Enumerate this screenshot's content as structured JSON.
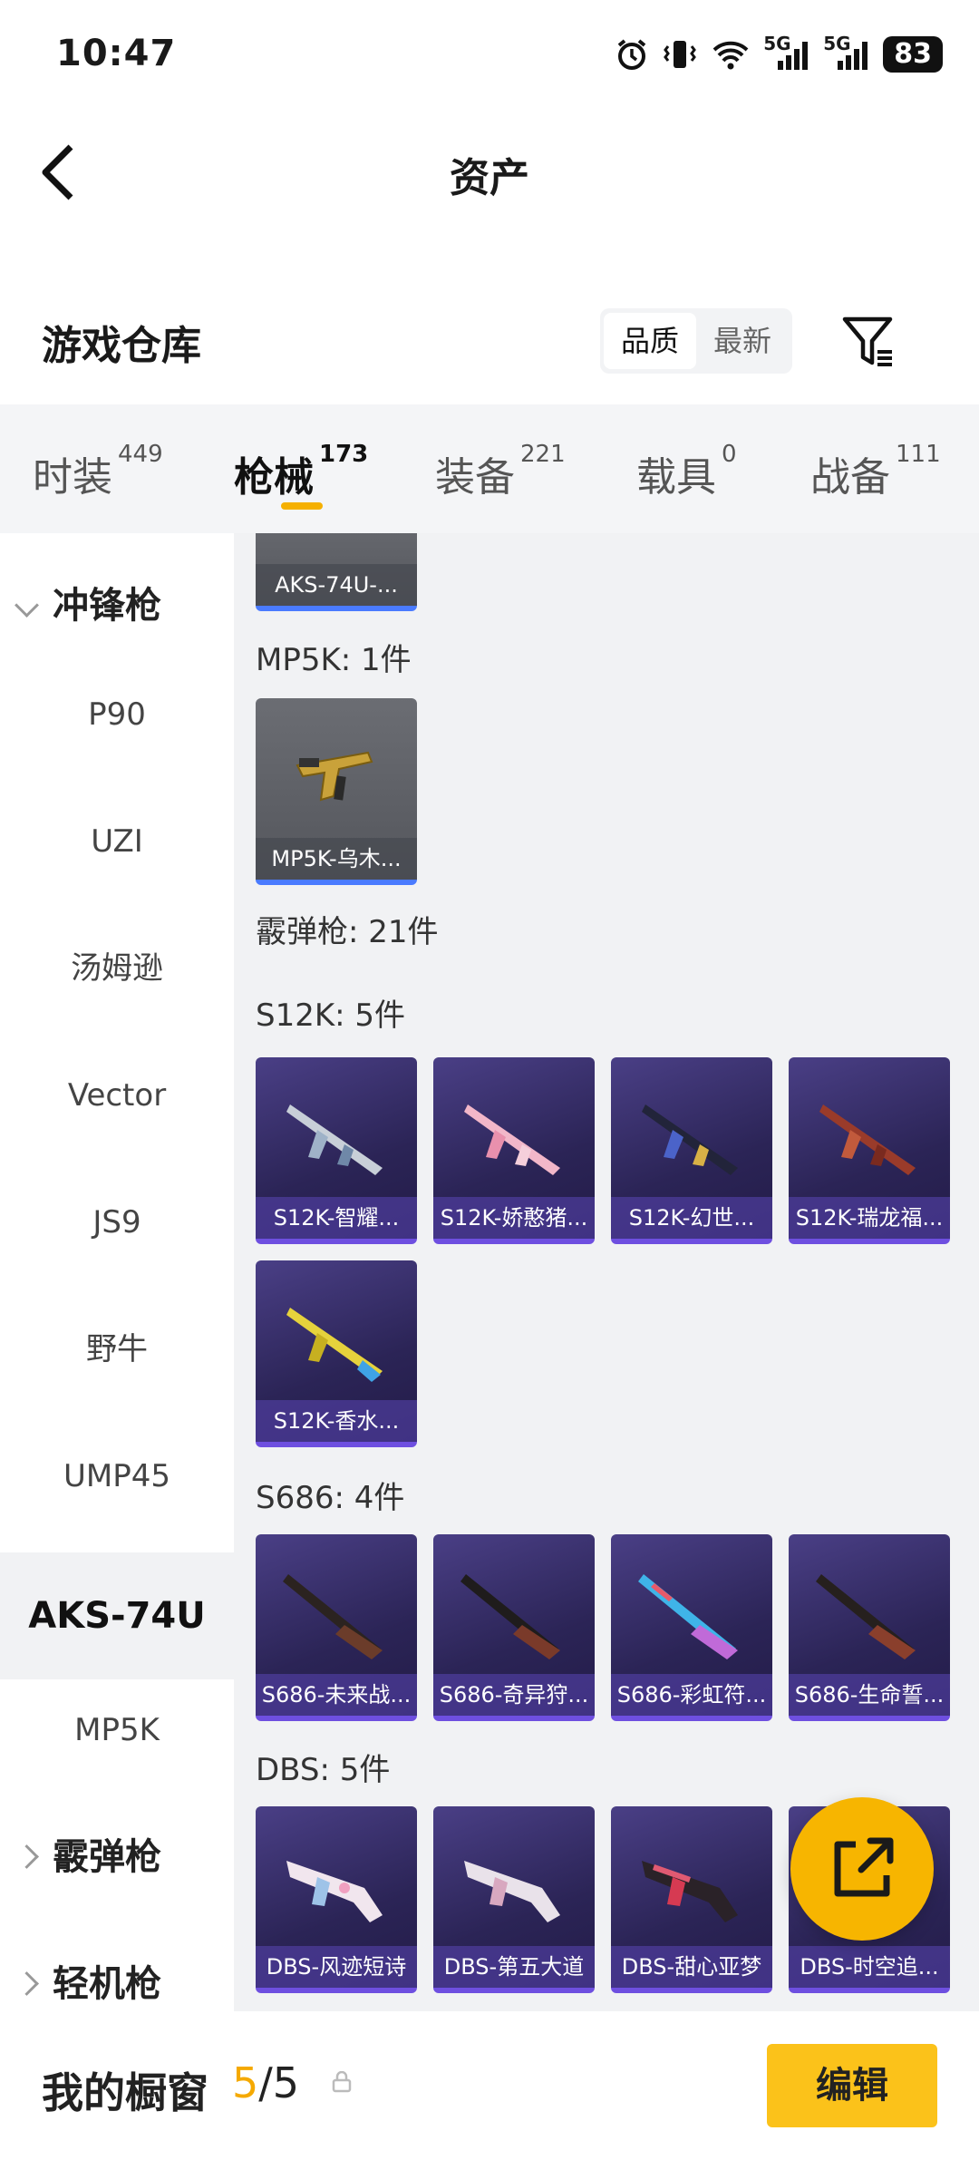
{
  "status_bar": {
    "time": "10:47",
    "signal_1": "5G",
    "signal_2": "5G",
    "battery": "83"
  },
  "header": {
    "title": "资产"
  },
  "warehouse": {
    "title": "游戏仓库",
    "sort_quality": "品质",
    "sort_newest": "最新"
  },
  "tabs": [
    {
      "label": "时装",
      "count": "449"
    },
    {
      "label": "枪械",
      "count": "173"
    },
    {
      "label": "装备",
      "count": "221"
    },
    {
      "label": "载具",
      "count": "0"
    },
    {
      "label": "战备",
      "count": "111"
    }
  ],
  "sidebar": {
    "group_smg": "冲锋枪",
    "items": [
      "P90",
      "UZI",
      "汤姆逊",
      "Vector",
      "JS9",
      "野牛",
      "UMP45",
      "AKS-74U",
      "MP5K"
    ],
    "selected": "AKS-74U",
    "group_shotgun": "霰弹枪",
    "group_lmg": "轻机枪"
  },
  "main": {
    "partial_card": "AKS-74U-...",
    "mp5k_label": "MP5K: 1件",
    "mp5k_cards": [
      "MP5K-乌木..."
    ],
    "shotgun_label": "霰弹枪: 21件",
    "s12k_label": "S12K: 5件",
    "s12k_cards": [
      "S12K-智耀...",
      "S12K-娇憨猪...",
      "S12K-幻世...",
      "S12K-瑞龙福...",
      "S12K-香水..."
    ],
    "s686_label": "S686: 4件",
    "s686_cards": [
      "S686-未来战...",
      "S686-奇异狩...",
      "S686-彩虹符...",
      "S686-生命誓..."
    ],
    "dbs_label": "DBS: 5件",
    "dbs_cards": [
      "DBS-风迹短诗",
      "DBS-第五大道",
      "DBS-甜心亚梦",
      "DBS-时空追..."
    ]
  },
  "bottom": {
    "showcase_label": "我的橱窗",
    "showcase_used": "5",
    "showcase_total": "/5",
    "edit": "编辑"
  },
  "colors": {
    "accent": "#f5b000",
    "card_purple": "#2b2456",
    "card_border": "#6e4fe0"
  }
}
